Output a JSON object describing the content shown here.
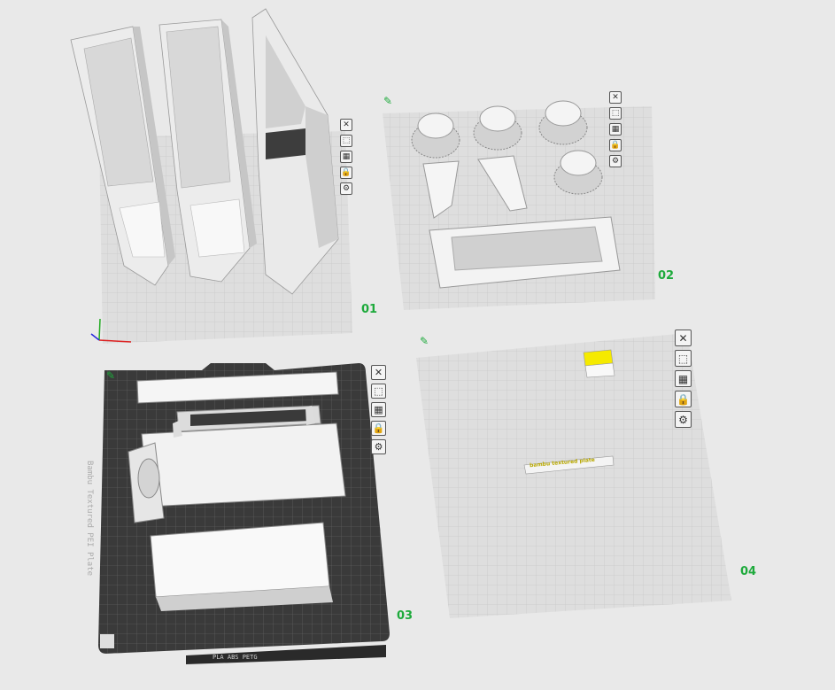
{
  "plates": [
    {
      "label": "01"
    },
    {
      "label": "02"
    },
    {
      "label": "03",
      "bed_text": "Bambu Textured PEI Plate",
      "bed_footer": "PLA ABS PETG"
    },
    {
      "label": "04",
      "engraved_text": "bambu textured plate"
    }
  ],
  "plate_toolbar": [
    {
      "icon": "close-icon",
      "glyph": "✕"
    },
    {
      "icon": "orient-icon",
      "glyph": "⬚"
    },
    {
      "icon": "arrange-icon",
      "glyph": "▦"
    },
    {
      "icon": "lock-icon",
      "glyph": "🔒"
    },
    {
      "icon": "settings-icon",
      "glyph": "⚙"
    }
  ],
  "colors": {
    "accent": "#1eaa3c",
    "plate": "#dcdcdc",
    "grid": "#c8c8c8",
    "dark_bed": "#3a3a3a",
    "model": "#f2f2f2",
    "yellow": "#f5ea00"
  }
}
